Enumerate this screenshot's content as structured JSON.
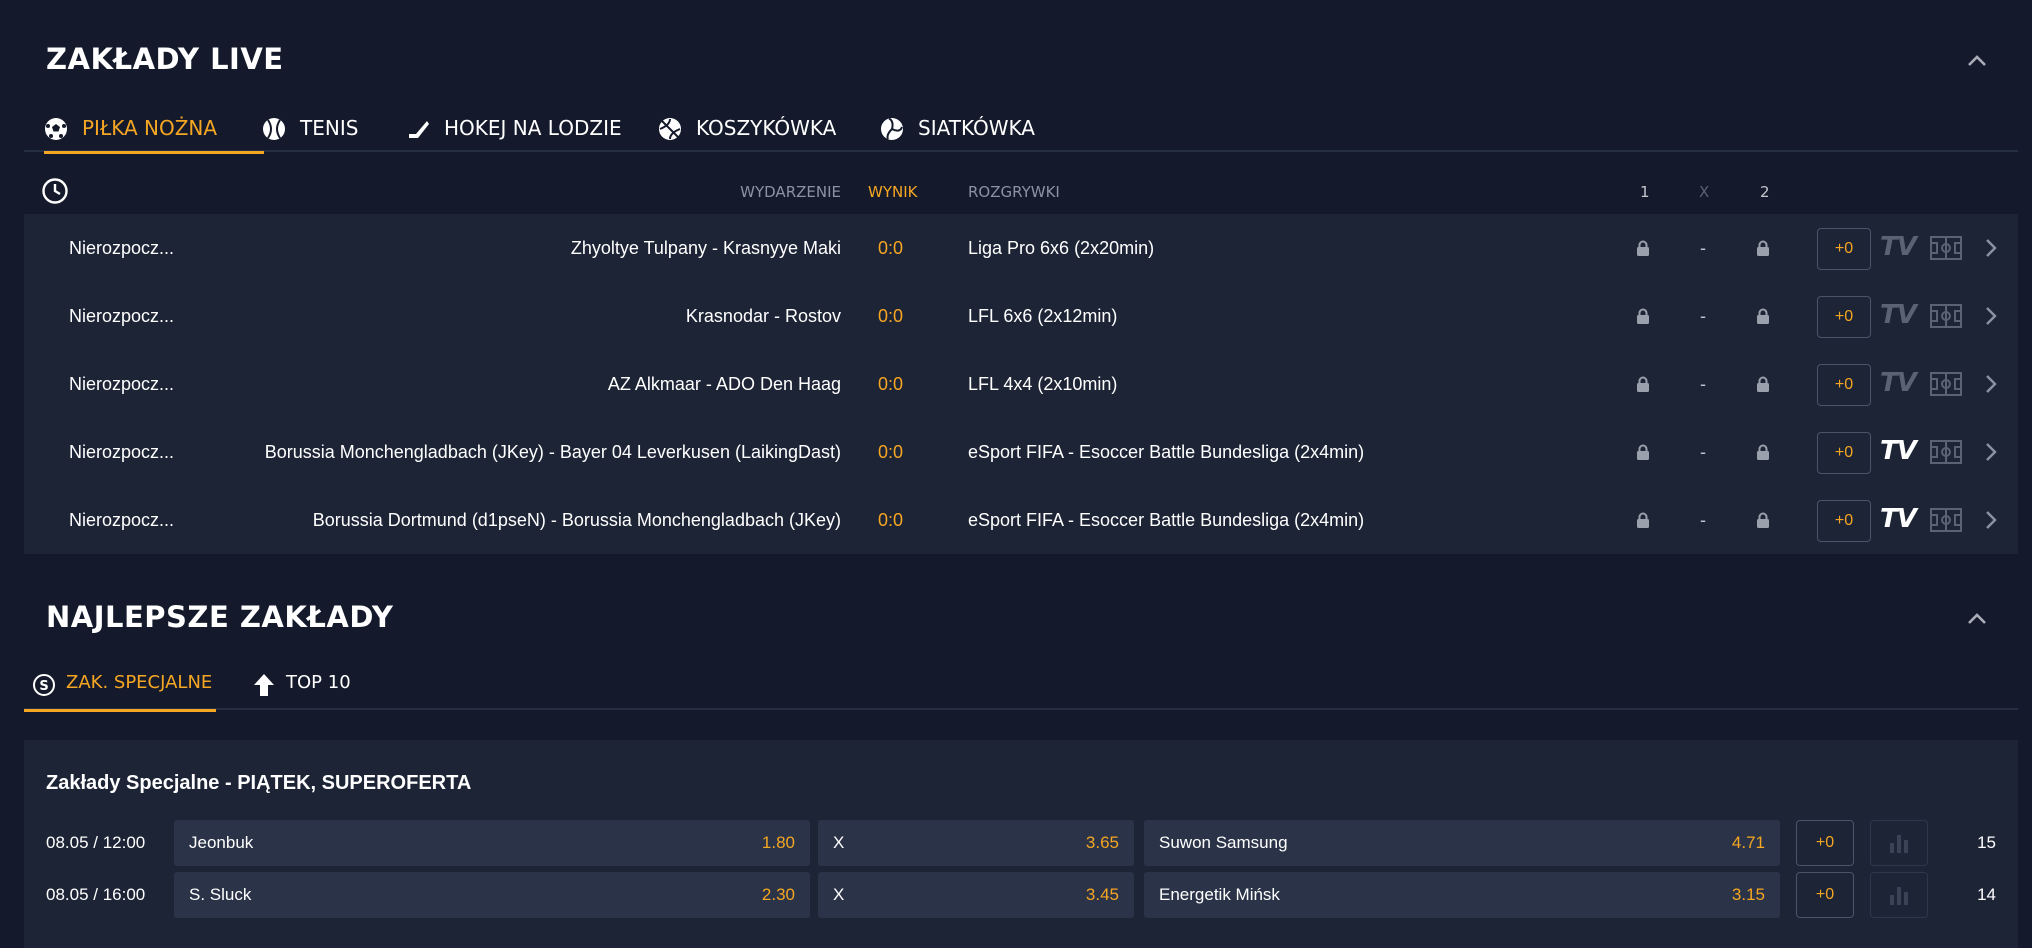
{
  "live": {
    "title": "ZAKŁADY LIVE",
    "tabs": [
      {
        "label": "PIŁKA NOŻNA",
        "icon": "soccer-ball-icon",
        "active": true
      },
      {
        "label": "TENIS",
        "icon": "tennis-ball-icon",
        "active": false
      },
      {
        "label": "HOKEJ NA LODZIE",
        "icon": "hockey-stick-icon",
        "active": false
      },
      {
        "label": "KOSZYKÓWKA",
        "icon": "basketball-icon",
        "active": false
      },
      {
        "label": "SIATKÓWKA",
        "icon": "volleyball-icon",
        "active": false
      }
    ],
    "headers": {
      "event": "WYDARZENIE",
      "score": "WYNIK",
      "league": "ROZGRYWKI",
      "one": "1",
      "x": "X",
      "two": "2"
    },
    "rows": [
      {
        "status": "Nierozpocz...",
        "event": "Zhyoltye Tulpany - Krasnyye Maki",
        "score": "0:0",
        "league": "Liga Pro 6x6 (2x20min)",
        "odd_x": "-",
        "plus": "+0",
        "tv": "TV",
        "tv_active": false
      },
      {
        "status": "Nierozpocz...",
        "event": "Krasnodar - Rostov",
        "score": "0:0",
        "league": "LFL 6x6 (2x12min)",
        "odd_x": "-",
        "plus": "+0",
        "tv": "TV",
        "tv_active": false
      },
      {
        "status": "Nierozpocz...",
        "event": "AZ Alkmaar - ADO Den Haag",
        "score": "0:0",
        "league": "LFL 4x4 (2x10min)",
        "odd_x": "-",
        "plus": "+0",
        "tv": "TV",
        "tv_active": false
      },
      {
        "status": "Nierozpocz...",
        "event": "Borussia Monchengladbach (JKey) - Bayer 04 Leverkusen (LaikingDast)",
        "score": "0:0",
        "league": "eSport FIFA - Esoccer Battle Bundesliga (2x4min)",
        "odd_x": "-",
        "plus": "+0",
        "tv": "TV",
        "tv_active": true
      },
      {
        "status": "Nierozpocz...",
        "event": "Borussia Dortmund (d1pseN) - Borussia Monchengladbach (JKey)",
        "score": "0:0",
        "league": "eSport FIFA - Esoccer Battle Bundesliga (2x4min)",
        "odd_x": "-",
        "plus": "+0",
        "tv": "TV",
        "tv_active": true
      }
    ]
  },
  "best": {
    "title": "NAJLEPSZE ZAKŁADY",
    "tabs": [
      {
        "label": "ZAK. SPECJALNE",
        "icon": "special-s-icon",
        "active": true
      },
      {
        "label": "TOP 10",
        "icon": "arrow-up-icon",
        "active": false
      }
    ],
    "card_title": "Zakłady Specjalne - PIĄTEK, SUPEROFERTA",
    "rows": [
      {
        "date": "08.05 / 12:00",
        "home": "Jeonbuk",
        "home_odd": "1.80",
        "draw": "X",
        "draw_odd": "3.65",
        "away": "Suwon Samsung",
        "away_odd": "4.71",
        "plus": "+0",
        "count": "15"
      },
      {
        "date": "08.05 / 16:00",
        "home": "S. Sluck",
        "home_odd": "2.30",
        "draw": "X",
        "draw_odd": "3.45",
        "away": "Energetik Mińsk",
        "away_odd": "3.15",
        "plus": "+0",
        "count": "14"
      }
    ]
  },
  "colors": {
    "background": "#141a2b",
    "panel": "#1d2436",
    "accent": "#f5a623",
    "option": "#2a3347"
  }
}
